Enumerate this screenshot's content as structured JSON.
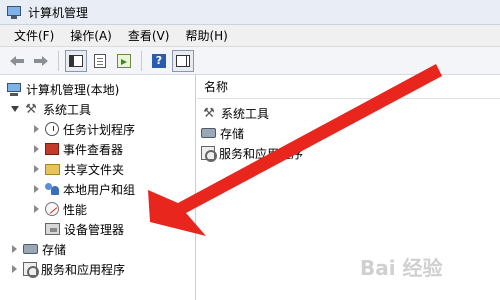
{
  "window": {
    "title": "计算机管理"
  },
  "menu": [
    "文件(F)",
    "操作(A)",
    "查看(V)",
    "帮助(H)"
  ],
  "tree": {
    "root": "计算机管理(本地)",
    "system_tools": "系统工具",
    "children": [
      "任务计划程序",
      "事件查看器",
      "共享文件夹",
      "本地用户和组",
      "性能",
      "设备管理器"
    ],
    "storage": "存储",
    "services": "服务和应用程序"
  },
  "right_pane": {
    "column_header": "名称",
    "items": [
      "系统工具",
      "存储",
      "服务和应用程序"
    ]
  },
  "colors": {
    "arrow": "#e8261d"
  },
  "watermark": "Bai 经验"
}
